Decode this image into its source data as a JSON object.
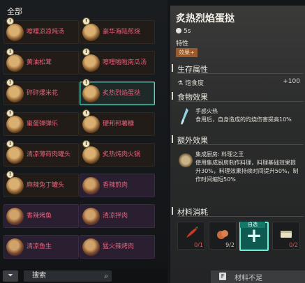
{
  "list": {
    "category_label": "全部",
    "items": [
      {
        "name": "嚓哩凉凉炖汤",
        "style": "brown",
        "badge": true
      },
      {
        "name": "豪华海陆煎烧",
        "style": "brown",
        "badge": true
      },
      {
        "name": "黄油松茸",
        "style": "brown",
        "badge": true
      },
      {
        "name": "嚓哩啪啦南瓜汤",
        "style": "brown",
        "badge": true
      },
      {
        "name": "砰砰爆米花",
        "style": "brown",
        "badge": true
      },
      {
        "name": "炙热烈焰蛋挞",
        "style": "selected",
        "badge": true
      },
      {
        "name": "蜜蛋弹弹乐",
        "style": "brown",
        "badge": true
      },
      {
        "name": "硬邦邦薯糖",
        "style": "brown",
        "badge": true
      },
      {
        "name": "清凉薄荷肉罐头",
        "style": "brown",
        "badge": true
      },
      {
        "name": "炙热炖肉火锅",
        "style": "brown",
        "badge": true
      },
      {
        "name": "麻辣兔丁罐头",
        "style": "brown",
        "badge": true
      },
      {
        "name": "香辣煎肉",
        "style": "purple",
        "badge": false
      },
      {
        "name": "香辣烤鱼",
        "style": "purple",
        "badge": false
      },
      {
        "name": "清凉拌肉",
        "style": "purple",
        "badge": false
      },
      {
        "name": "清凉鱼生",
        "style": "purple",
        "badge": false
      },
      {
        "name": "猛火辣烤肉",
        "style": "purple",
        "badge": false
      }
    ]
  },
  "toolbar": {
    "search_placeholder": "搜索",
    "filter_icon": "filter-icon",
    "search_icon": "search-icon"
  },
  "detail": {
    "title": "炙热烈焰蛋挞",
    "time": "5s",
    "trait_label": "特性",
    "trait_tag": "效果+",
    "survival_header": "生存属性",
    "stats": [
      {
        "label": "饱食度",
        "value": "+100"
      }
    ],
    "food_effect_header": "食物效果",
    "food_effect_title": "手感火热",
    "food_effect_desc": "食用后，自身造成的灼烧伤害提高10%",
    "extra_header": "额外效果",
    "extra_title": "集成厨房: 料理之王",
    "extra_desc": "使用集成厨房制作料理，料理基础效果提升30%，料理效果持续时间提升50%，制作时间缩短50%",
    "materials_header": "材料消耗",
    "materials": [
      {
        "icon": "chili-pepper-icon",
        "count": "0/1",
        "insufficient": true
      },
      {
        "icon": "egg-icon",
        "count": "9/2",
        "insufficient": false
      },
      {
        "icon": "add-icon",
        "count": "",
        "insufficient": false
      },
      {
        "icon": "flour-icon",
        "count": "0/2",
        "insufficient": true
      }
    ],
    "auto_select_label": "自选",
    "craft_key": "F",
    "craft_label": "材料不足"
  },
  "colors": {
    "item_name": "#e95f79",
    "selected_border": "#5fd6c2",
    "add_button": "#0f5a50",
    "insufficient": "#e35b5b"
  }
}
